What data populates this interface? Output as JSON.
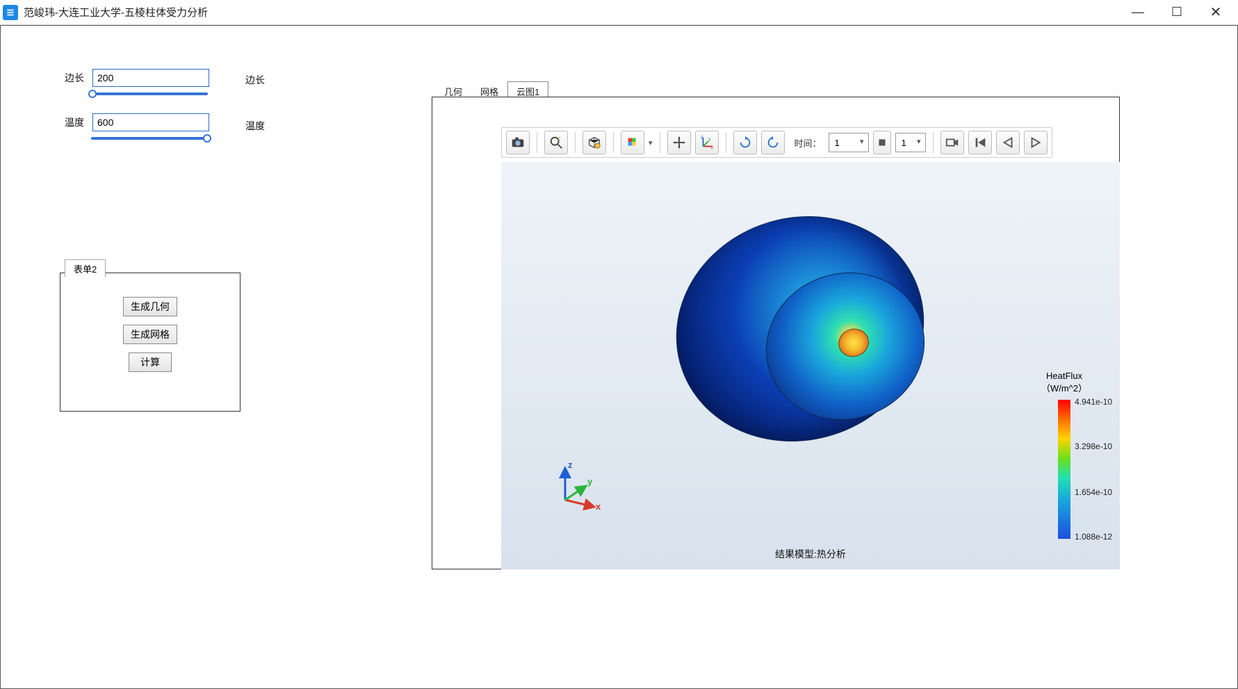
{
  "window": {
    "title": "范峻玮-大连工业大学-五棱柱体受力分析"
  },
  "params": {
    "edge_label": "边长",
    "edge_value": "200",
    "edge_side_label": "边长",
    "temp_label": "温度",
    "temp_value": "600",
    "temp_side_label": "温度"
  },
  "form": {
    "tab_label": "表单2",
    "btn_geom": "生成几何",
    "btn_mesh": "生成网格",
    "btn_calc": "计算"
  },
  "viewer": {
    "tabs": {
      "geom": "几何",
      "mesh": "网格",
      "cloud": "云图1"
    },
    "time_label": "时间：",
    "time_value": "1",
    "frame_value": "1",
    "result_caption": "结果模型:热分析"
  },
  "legend": {
    "title_line1": "HeatFlux",
    "title_line2": "（W/m^2）",
    "ticks": {
      "max": "4.941e-10",
      "t2": "3.298e-10",
      "t1": "1.654e-10",
      "min": "1.088e-12"
    }
  },
  "axes": {
    "x": "x",
    "y": "y",
    "z": "z"
  }
}
